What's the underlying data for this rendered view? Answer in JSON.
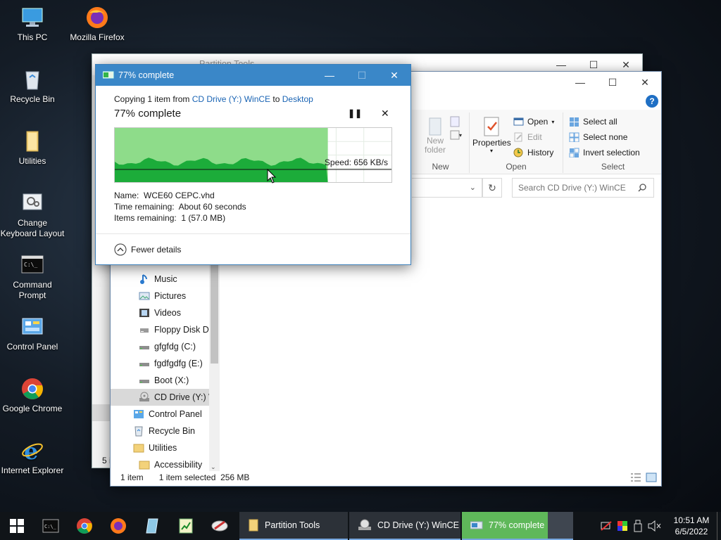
{
  "desktop": {
    "icons": [
      {
        "label": "This PC",
        "icon": "computer-icon"
      },
      {
        "label": "Mozilla Firefox",
        "icon": "firefox-icon"
      },
      {
        "label": "Recycle Bin",
        "icon": "recycle-bin-icon"
      },
      {
        "label": "Utilities",
        "icon": "folder-icon"
      },
      {
        "label": "Change Keyboard Layout",
        "icon": "keyboard-layout-icon"
      },
      {
        "label": "Command Prompt",
        "icon": "cmd-icon"
      },
      {
        "label": "Control Panel",
        "icon": "control-panel-icon"
      },
      {
        "label": "Google Chrome",
        "icon": "chrome-icon"
      },
      {
        "label": "Internet Explorer",
        "icon": "ie-icon"
      }
    ]
  },
  "back_window": {
    "title": "Partition Tools",
    "status": "5 i"
  },
  "explorer": {
    "ribbon": {
      "new_group": {
        "new_folder": "New folder",
        "label": "New"
      },
      "open_group": {
        "properties": "Properties",
        "open": "Open",
        "edit": "Edit",
        "history": "History",
        "label": "Open"
      },
      "select_group": {
        "select_all": "Select all",
        "select_none": "Select none",
        "invert_selection": "Invert selection",
        "label": "Select"
      }
    },
    "search_placeholder": "Search CD Drive (Y:) WinCE",
    "nav_items": [
      {
        "label": "Music",
        "icon": "music-icon"
      },
      {
        "label": "Pictures",
        "icon": "pictures-icon"
      },
      {
        "label": "Videos",
        "icon": "videos-icon"
      },
      {
        "label": "Floppy Disk Dri",
        "icon": "floppy-icon"
      },
      {
        "label": "gfgfdg (C:)",
        "icon": "drive-icon"
      },
      {
        "label": "fgdfgdfg (E:)",
        "icon": "drive-icon"
      },
      {
        "label": "Boot (X:)",
        "icon": "drive-icon"
      },
      {
        "label": "CD Drive (Y:) W",
        "icon": "cd-drive-icon"
      },
      {
        "label": "Control Panel",
        "icon": "control-panel-icon"
      },
      {
        "label": "Recycle Bin",
        "icon": "recycle-bin-icon"
      },
      {
        "label": "Utilities",
        "icon": "folder-icon"
      },
      {
        "label": "Accessibility",
        "icon": "folder-icon"
      }
    ],
    "status": {
      "items": "1 item",
      "selected": "1 item selected",
      "size": "256 MB"
    }
  },
  "copy_dialog": {
    "title": "77% complete",
    "copying_prefix": "Copying 1 item from",
    "source": "CD Drive (Y:) WinCE",
    "to_word": "to",
    "destination": "Desktop",
    "heading": "77% complete",
    "progress": 0.77,
    "speed": "Speed: 656 KB/s",
    "name_label": "Name:",
    "name_value": "WCE60 CEPC.vhd",
    "time_label": "Time remaining:",
    "time_value": "About 60 seconds",
    "items_label": "Items remaining:",
    "items_value": "1 (57.0 MB)",
    "fewer_details": "Fewer details"
  },
  "taskbar": {
    "tasks": [
      {
        "label": "Partition Tools",
        "icon": "folder-icon"
      },
      {
        "label": "CD Drive (Y:) WinCE",
        "icon": "cd-drive-icon"
      },
      {
        "label": "77% complete",
        "icon": "copy-progress-icon"
      }
    ],
    "time": "10:51 AM",
    "date": "6/5/2022"
  },
  "colors": {
    "accent": "#3a87c8",
    "progress_fill": "#8edc8a",
    "progress_bar": "#1cac3a",
    "link": "#1a64b4"
  }
}
